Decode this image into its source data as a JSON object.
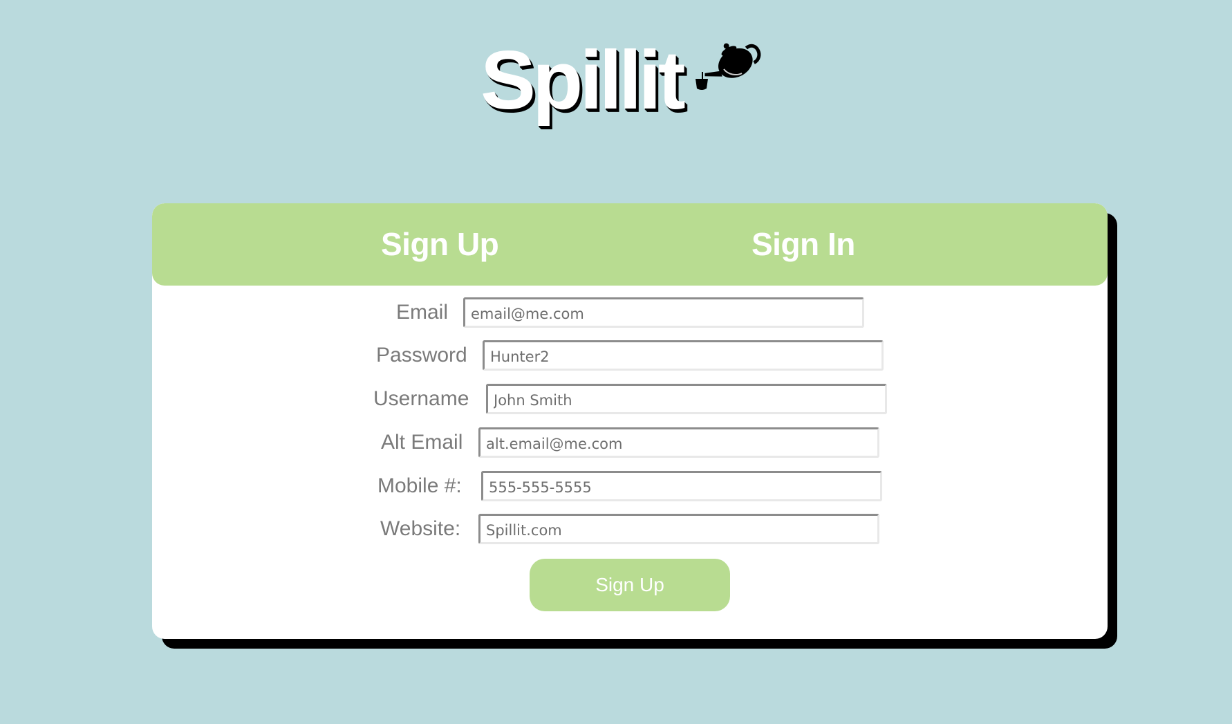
{
  "app": {
    "logo_text": "Spillit",
    "logo_icon": "teapot-icon"
  },
  "tabs": [
    {
      "label": "Sign Up",
      "active": true
    },
    {
      "label": "Sign In",
      "active": false
    }
  ],
  "form": {
    "fields": [
      {
        "label": "Email",
        "placeholder": "email@me.com",
        "value": ""
      },
      {
        "label": "Password",
        "placeholder": "Hunter2",
        "value": ""
      },
      {
        "label": "Username",
        "placeholder": "John Smith",
        "value": ""
      },
      {
        "label": "Alt Email",
        "placeholder": "alt.email@me.com",
        "value": ""
      },
      {
        "label": "Mobile #:",
        "placeholder": "555-555-5555",
        "value": ""
      },
      {
        "label": "Website:",
        "placeholder": "Spillit.com",
        "value": ""
      }
    ],
    "submit_label": "Sign Up"
  },
  "colors": {
    "background": "#badadd",
    "accent_green": "#b8dc91",
    "card": "#ffffff",
    "shadow": "#000000",
    "label_text": "#7a7a7a"
  }
}
